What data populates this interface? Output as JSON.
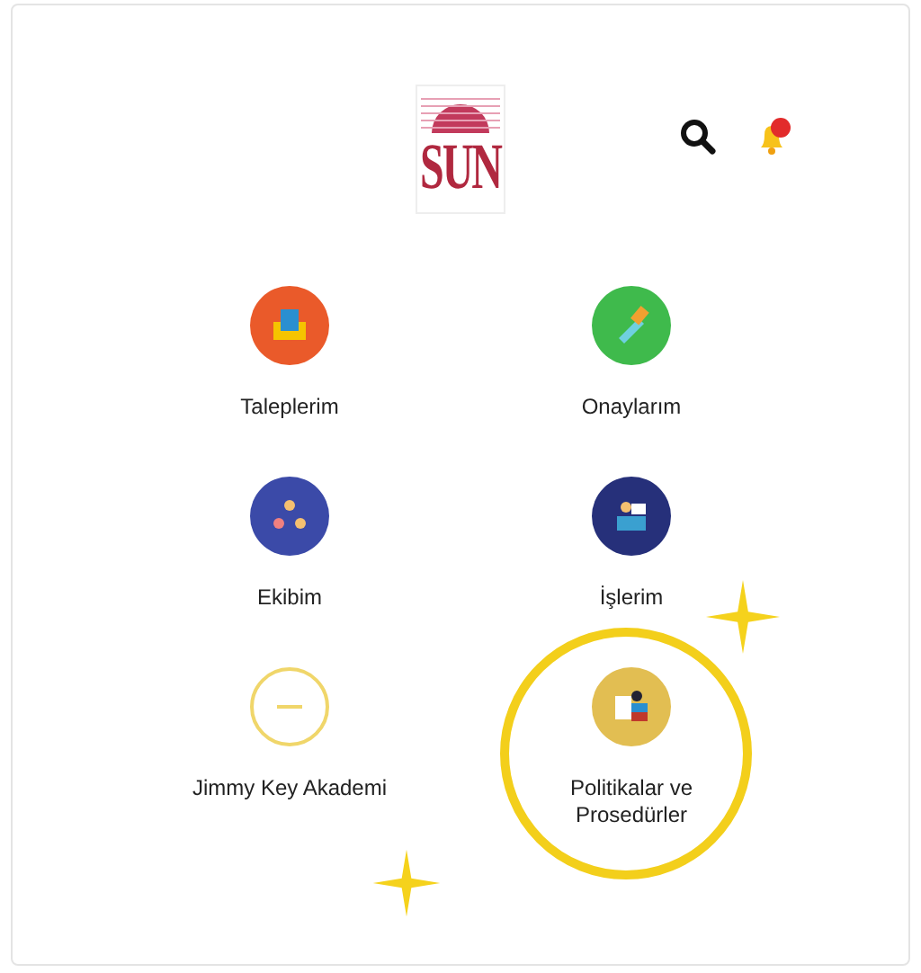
{
  "header": {
    "logo_text": "SUN",
    "notification_badge": true
  },
  "menu": [
    {
      "label": "Taleplerim",
      "kind": "app",
      "color": "#ea5a2a",
      "highlighted": false
    },
    {
      "label": "Onaylarım",
      "kind": "app",
      "color": "#3fba4c",
      "highlighted": false
    },
    {
      "label": "Ekibim",
      "kind": "app",
      "color": "#3b4aa8",
      "highlighted": false
    },
    {
      "label": "İşlerim",
      "kind": "app",
      "color": "#26307a",
      "highlighted": false
    },
    {
      "label": "Jimmy Key Akademi",
      "kind": "logo",
      "color": "#f0d66a",
      "highlighted": false
    },
    {
      "label": "Politikalar ve Prosedürler",
      "kind": "app",
      "color": "#e2be52",
      "highlighted": true
    }
  ]
}
